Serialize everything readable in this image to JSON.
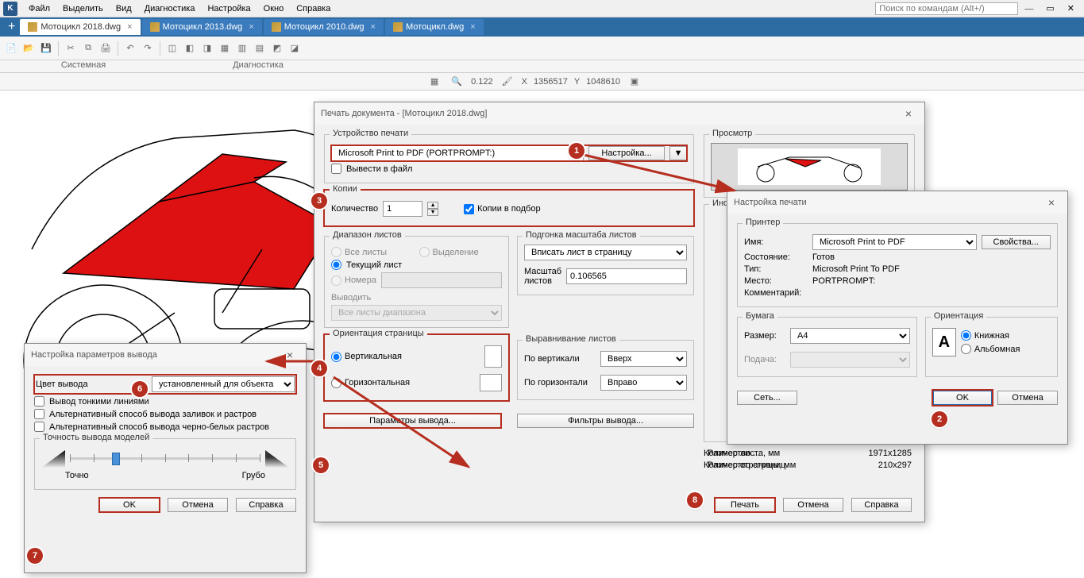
{
  "menubar": {
    "items": [
      "Файл",
      "Выделить",
      "Вид",
      "Диагностика",
      "Настройка",
      "Окно",
      "Справка"
    ],
    "search_placeholder": "Поиск по командам (Alt+/)"
  },
  "tabs": {
    "items": [
      {
        "label": "Мотоцикл 2018.dwg",
        "active": true
      },
      {
        "label": "Мотоцикл 2013.dwg",
        "active": false
      },
      {
        "label": "Мотоцикл 2010.dwg",
        "active": false
      },
      {
        "label": "Мотоцикл.dwg",
        "active": false
      }
    ]
  },
  "toolbar_groups": {
    "g1": "Системная",
    "g2": "Диагностика"
  },
  "status": {
    "zoom": "0.122",
    "x_lbl": "X",
    "x": "1356517",
    "y_lbl": "Y",
    "y": "1048610"
  },
  "printDialog": {
    "title": "Печать документа - [Мотоцикл 2018.dwg]",
    "device_group": "Устройство печати",
    "printer_name": "Microsoft Print to PDF (PORTPROMPT:)",
    "settings_btn": "Настройка...",
    "to_file": "Вывести в файл",
    "copies_group": "Копии",
    "count_lbl": "Количество",
    "count_val": "1",
    "collate": "Копии в подбор",
    "range_group": "Диапазон листов",
    "range_all": "Все листы",
    "range_sel": "Выделение",
    "range_cur": "Текущий лист",
    "range_num": "Номера",
    "output_lbl": "Выводить",
    "output_val": "Все листы диапазона",
    "fit_group": "Подгонка масштаба листов",
    "fit_val": "Вписать лист в страницу",
    "scale_lbl": "Масштаб листов",
    "scale_val": "0.106565",
    "orient_group": "Ориентация страницы",
    "orient_v": "Вертикальная",
    "orient_h": "Горизонтальная",
    "align_group": "Выравнивание листов",
    "align_v_lbl": "По вертикали",
    "align_v_val": "Вверх",
    "align_h_lbl": "По горизонтали",
    "align_h_val": "Вправо",
    "params_btn": "Параметры вывода...",
    "filters_btn": "Фильтры вывода...",
    "preview_group": "Просмотр",
    "info_group": "Информация",
    "info_l1": "Количество ...",
    "info_l2": "Количество страниц",
    "info_l3": "Размер листа, мм",
    "info_v3": "1971x1285",
    "info_l4": "Размер страницы, мм",
    "info_v4": "210x297",
    "print_btn": "Печать",
    "cancel_btn": "Отмена",
    "help_btn": "Справка"
  },
  "printSetup": {
    "title": "Настройка печати",
    "printer_group": "Принтер",
    "name_lbl": "Имя:",
    "name_val": "Microsoft Print to PDF",
    "props_btn": "Свойства...",
    "state_lbl": "Состояние:",
    "state_val": "Готов",
    "type_lbl": "Тип:",
    "type_val": "Microsoft Print To PDF",
    "place_lbl": "Место:",
    "place_val": "PORTPROMPT:",
    "comment_lbl": "Комментарий:",
    "paper_group": "Бумага",
    "size_lbl": "Размер:",
    "size_val": "A4",
    "feed_lbl": "Подача:",
    "orient_group": "Ориентация",
    "orient_p": "Книжная",
    "orient_l": "Альбомная",
    "net_btn": "Сеть...",
    "ok_btn": "OK",
    "cancel_btn": "Отмена"
  },
  "outputParams": {
    "title": "Настройка параметров вывода",
    "color_lbl": "Цвет вывода",
    "color_val": "установленный для объекта",
    "thin": "Вывод тонкими линиями",
    "alt1": "Альтернативный способ вывода заливок и растров",
    "alt2": "Альтернативный способ вывода черно-белых растров",
    "precision_lbl": "Точность вывода моделей",
    "fine": "Точно",
    "coarse": "Грубо",
    "ok_btn": "OK",
    "cancel_btn": "Отмена",
    "help_btn": "Справка"
  },
  "badges": {
    "b1": "1",
    "b2": "2",
    "b3": "3",
    "b4": "4",
    "b5": "5",
    "b6": "6",
    "b7": "7",
    "b8": "8"
  }
}
